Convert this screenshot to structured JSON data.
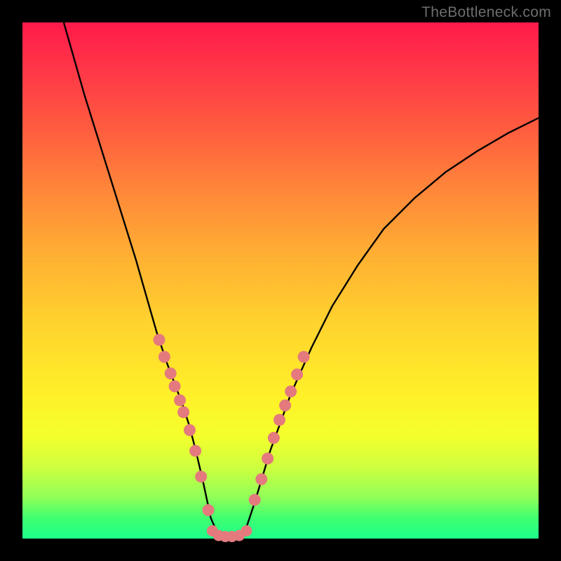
{
  "watermark": "TheBottleneck.com",
  "chart_data": {
    "type": "line",
    "title": "",
    "xlabel": "",
    "ylabel": "",
    "xlim": [
      0,
      1
    ],
    "ylim": [
      0,
      1
    ],
    "curve": {
      "x": [
        0.08,
        0.12,
        0.145,
        0.17,
        0.195,
        0.22,
        0.24,
        0.26,
        0.28,
        0.295,
        0.31,
        0.323,
        0.336,
        0.35,
        0.365,
        0.38,
        0.43,
        0.45,
        0.48,
        0.52,
        0.56,
        0.6,
        0.65,
        0.7,
        0.76,
        0.82,
        0.88,
        0.94,
        1.0
      ],
      "y": [
        1.0,
        0.86,
        0.78,
        0.7,
        0.62,
        0.54,
        0.47,
        0.4,
        0.34,
        0.3,
        0.26,
        0.22,
        0.17,
        0.11,
        0.04,
        0.005,
        0.01,
        0.07,
        0.17,
        0.28,
        0.37,
        0.45,
        0.53,
        0.6,
        0.66,
        0.71,
        0.75,
        0.785,
        0.815
      ]
    },
    "series": [
      {
        "name": "markers-left",
        "x": [
          0.265,
          0.275,
          0.287,
          0.295,
          0.305,
          0.312,
          0.324,
          0.335,
          0.346,
          0.36
        ],
        "y": [
          0.385,
          0.352,
          0.32,
          0.295,
          0.268,
          0.245,
          0.21,
          0.17,
          0.12,
          0.055
        ]
      },
      {
        "name": "markers-right",
        "x": [
          0.45,
          0.463,
          0.475,
          0.487,
          0.498,
          0.509,
          0.52,
          0.532,
          0.545
        ],
        "y": [
          0.075,
          0.115,
          0.155,
          0.195,
          0.23,
          0.258,
          0.285,
          0.318,
          0.352
        ]
      },
      {
        "name": "markers-bottom-cluster",
        "x": [
          0.368,
          0.38,
          0.393,
          0.406,
          0.42,
          0.434
        ],
        "y": [
          0.015,
          0.006,
          0.004,
          0.004,
          0.006,
          0.015
        ]
      }
    ],
    "colors": {
      "curve": "#000000",
      "markers": "#e47a7d",
      "gradient_top": "#ff1a4b",
      "gradient_bottom": "#1dff8a"
    }
  }
}
